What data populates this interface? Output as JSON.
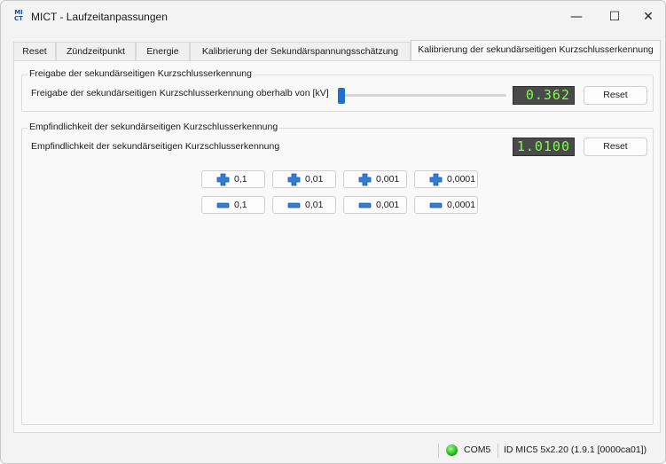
{
  "window": {
    "title": "MICT - Laufzeitanpassungen",
    "icon_lines": [
      "MI",
      "CT"
    ],
    "controls": {
      "minimize": "—",
      "maximize": "☐",
      "close": "✕"
    }
  },
  "tabs": [
    {
      "label": "Reset",
      "active": false
    },
    {
      "label": "Zündzeitpunkt",
      "active": false
    },
    {
      "label": "Energie",
      "active": false
    },
    {
      "label": "Kalibrierung der Sekundärspannungsschätzung",
      "active": false
    },
    {
      "label": "Kalibrierung der sekundärseitigen Kurzschlusserkennung",
      "active": true
    }
  ],
  "release_group": {
    "title": "Freigabe der sekundärseitigen Kurzschlusserkennung",
    "label": "Freigabe der sekundärseitigen Kurzschlusserkennung oberhalb von [kV]",
    "slider_level": 0.0,
    "display_value": "0.362",
    "reset_label": "Reset"
  },
  "sensitivity_group": {
    "title": "Empfindlichkeit der sekundärseitigen Kurzschlusserkennung",
    "label": "Empfindlichkeit der sekundärseitigen Kurzschlusserkennung",
    "display_value": "1.0100",
    "reset_label": "Reset",
    "increment_buttons": [
      "0,1",
      "0,01",
      "0,001",
      "0,0001"
    ],
    "decrement_buttons": [
      "0,1",
      "0,01",
      "0,001",
      "0,0001"
    ]
  },
  "statusbar": {
    "led_color": "#21b817",
    "port": "COM5",
    "device_id": "ID MIC5 5x2.20 (1.9.1 [0000ca01])"
  },
  "colors": {
    "accent": "#1e6fd0",
    "lcd_background": "#4a4a4a",
    "lcd_digits": "#7cff4a"
  }
}
